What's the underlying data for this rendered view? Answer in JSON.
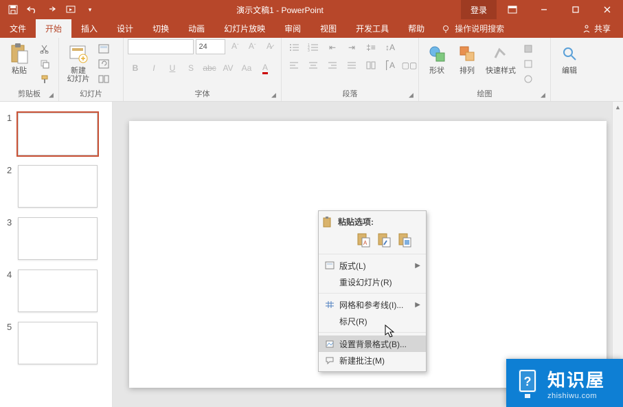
{
  "title": "演示文稿1 - PowerPoint",
  "login": "登录",
  "tabs": [
    "文件",
    "开始",
    "插入",
    "设计",
    "切换",
    "动画",
    "幻灯片放映",
    "审阅",
    "视图",
    "开发工具",
    "帮助"
  ],
  "activeTab": 1,
  "tellMe": "操作说明搜索",
  "share": "共享",
  "ribbon": {
    "clipboard": {
      "paste": "粘贴",
      "label": "剪贴板"
    },
    "slides": {
      "newSlide": "新建\n幻灯片",
      "label": "幻灯片"
    },
    "font": {
      "size": "24",
      "label": "字体"
    },
    "paragraph": {
      "label": "段落"
    },
    "drawing": {
      "shapes": "形状",
      "arrange": "排列",
      "quickStyles": "快速样式",
      "label": "绘图"
    },
    "editing": {
      "label": "编辑"
    }
  },
  "thumbnails": [
    1,
    2,
    3,
    4,
    5
  ],
  "selectedThumb": 1,
  "contextMenu": {
    "pasteOptions": "粘贴选项:",
    "layout": "版式(L)",
    "resetSlide": "重设幻灯片(R)",
    "guides": "网格和参考线(I)...",
    "ruler": "标尺(R)",
    "formatBackground": "设置背景格式(B)...",
    "newComment": "新建批注(M)"
  },
  "watermark": {
    "title": "知识屋",
    "sub": "zhishiwu.com"
  }
}
